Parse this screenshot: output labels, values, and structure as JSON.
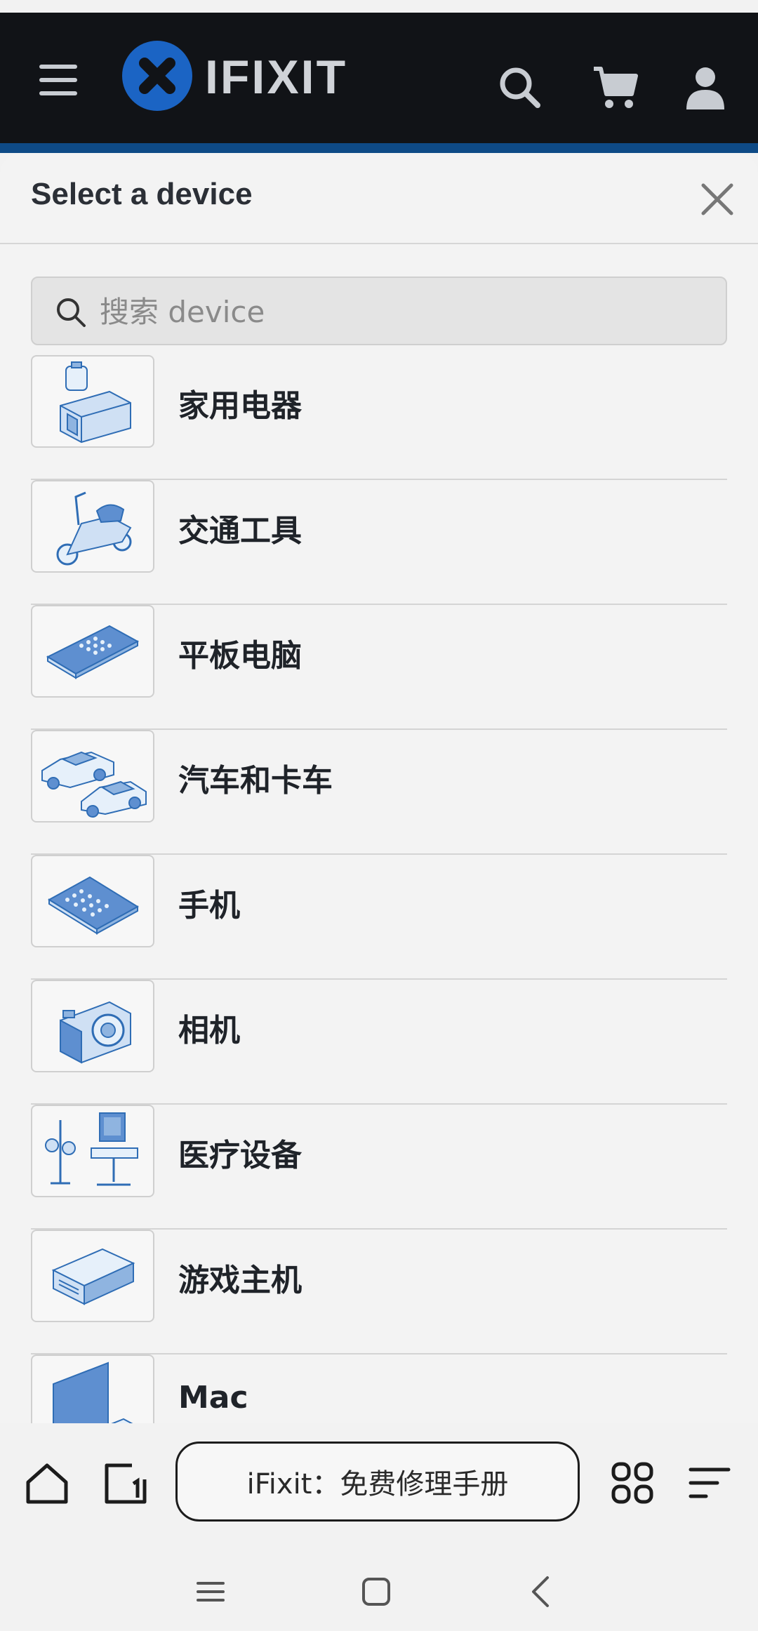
{
  "header": {
    "logo_text": "IFIXIT",
    "menu_icon": "hamburger-icon",
    "search_icon": "search-icon",
    "cart_icon": "cart-icon",
    "account_icon": "user-icon",
    "brand_color": "#1b64c4",
    "bar_color": "#111317"
  },
  "sheet": {
    "title": "Select a device",
    "close_icon": "close-icon",
    "search": {
      "placeholder": "搜索 device",
      "value": ""
    },
    "items": [
      {
        "label": "家用电器",
        "icon": "appliances-icon"
      },
      {
        "label": "交通工具",
        "icon": "scooter-icon"
      },
      {
        "label": "平板电脑",
        "icon": "tablet-icon"
      },
      {
        "label": "汽车和卡车",
        "icon": "cars-icon"
      },
      {
        "label": "手机",
        "icon": "phone-icon"
      },
      {
        "label": "相机",
        "icon": "camera-icon"
      },
      {
        "label": "医疗设备",
        "icon": "medical-icon"
      },
      {
        "label": "游戏主机",
        "icon": "console-icon"
      },
      {
        "label": "Mac",
        "icon": "mac-icon"
      }
    ]
  },
  "browser": {
    "url_title": "iFixit：免费修理手册",
    "home_icon": "home-icon",
    "tabs_icon": "tab-counter-icon",
    "apps_icon": "grid-icon",
    "menu_icon": "menu-lines-icon"
  },
  "system_nav": {
    "recents_icon": "recents-icon",
    "home_icon": "home-square-icon",
    "back_icon": "back-icon"
  }
}
